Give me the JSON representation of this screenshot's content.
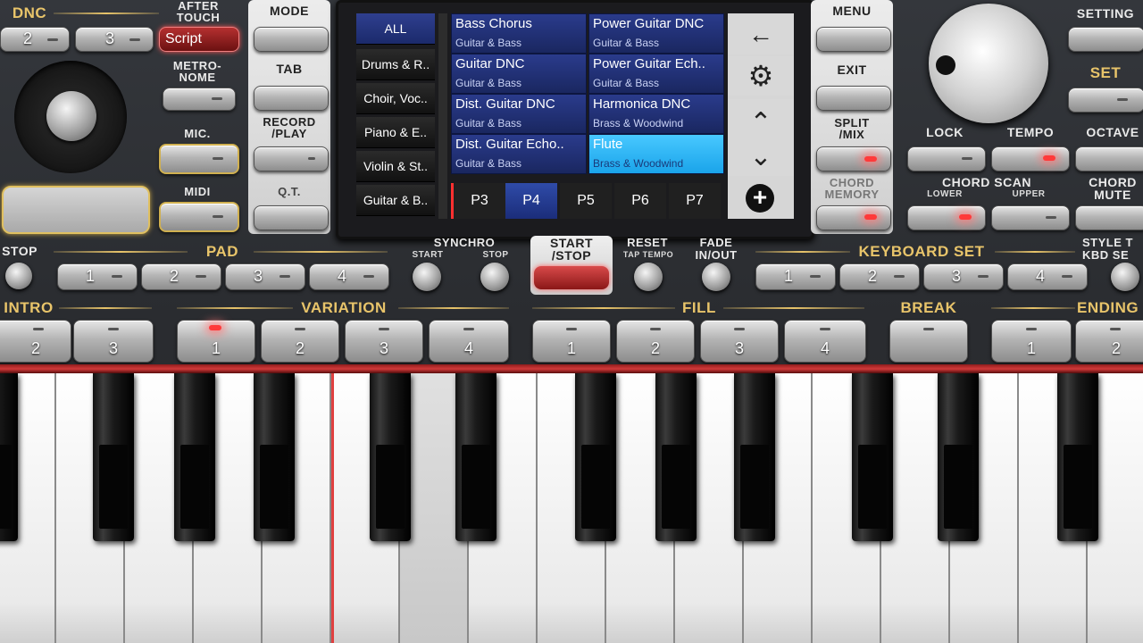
{
  "top_left": {
    "dnc": "DNC",
    "after_touch": "AFTER\nTOUCH",
    "btn2": "2",
    "btn3": "3",
    "script": "Script",
    "metronome": "METRO-\nNOME",
    "mic": "MIC.",
    "midi": "MIDI"
  },
  "left_col": {
    "mode": "MODE",
    "tab": "TAB",
    "record_play": "RECORD\n/PLAY",
    "qt": "Q.T."
  },
  "screen": {
    "categories": [
      {
        "label": "ALL"
      },
      {
        "label": "Drums & R.."
      },
      {
        "label": "Choir, Voc.."
      },
      {
        "label": "Piano & E.."
      },
      {
        "label": "Violin & St.."
      },
      {
        "label": "Guitar & B.."
      }
    ],
    "styles": [
      {
        "title": "Bass Chorus",
        "sub": "Guitar & Bass"
      },
      {
        "title": "Power Guitar DNC",
        "sub": "Guitar & Bass"
      },
      {
        "title": "Guitar DNC",
        "sub": "Guitar & Bass"
      },
      {
        "title": "Power Guitar Ech..",
        "sub": "Guitar & Bass"
      },
      {
        "title": "Dist. Guitar DNC",
        "sub": "Guitar & Bass"
      },
      {
        "title": "Harmonica DNC",
        "sub": "Brass & Woodwind"
      },
      {
        "title": "Dist. Guitar Echo..",
        "sub": "Guitar & Bass"
      },
      {
        "title": "Flute",
        "sub": "Brass & Woodwind"
      }
    ],
    "pages": [
      "P3",
      "P4",
      "P5",
      "P6",
      "P7"
    ],
    "selected_page": "P4",
    "nav": {
      "back": "←",
      "settings": "⚙",
      "up": "⌃",
      "down": "⌄",
      "add": "+"
    }
  },
  "right_col": {
    "menu": "MENU",
    "exit": "EXIT",
    "split_mix": "SPLIT\n/MIX",
    "chord_memory": "CHORD\nMEMORY"
  },
  "far_right": {
    "setting": "SETTING",
    "set": "SET",
    "lock": "LOCK",
    "tempo": "TEMPO",
    "octave": "OCTAVE",
    "chord_scan": "CHORD SCAN",
    "lower": "LOWER",
    "upper": "UPPER",
    "chord_mute": "CHORD\nMUTE"
  },
  "row2": {
    "stop": "STOP",
    "pad": "PAD",
    "pad_buttons": [
      "1",
      "2",
      "3",
      "4"
    ],
    "synchro": "SYNCHRO",
    "start": "START",
    "stop_small": "STOP",
    "start_stop": "START\n/STOP",
    "reset": "RESET",
    "tap_tempo": "TAP TEMPO",
    "fade": "FADE\nIN/OUT",
    "keyboard_set": "KEYBOARD SET",
    "kbd_buttons": [
      "1",
      "2",
      "3",
      "4"
    ],
    "style_kbd": "STYLE T\nKBD SE"
  },
  "row3": {
    "intro": "INTRO",
    "intro_buttons": [
      "2",
      "3"
    ],
    "variation": "VARIATION",
    "variation_buttons": [
      "1",
      "2",
      "3",
      "4"
    ],
    "fill": "FILL",
    "fill_buttons": [
      "1",
      "2",
      "3",
      "4"
    ],
    "break": "BREAK",
    "ending": "ENDING",
    "ending_buttons": [
      "1",
      "2"
    ]
  },
  "colors": {
    "accent": "#e8c46a",
    "screen_selected": "#1aa4ea",
    "led": "#ff3a3a"
  }
}
